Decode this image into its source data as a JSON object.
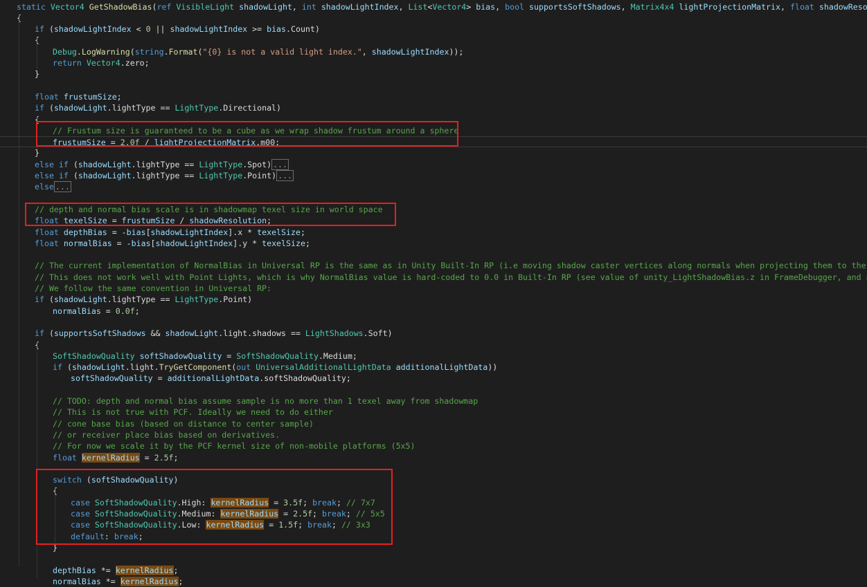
{
  "editor": {
    "lines": [
      {
        "t": [
          {
            "s": "static ",
            "c": "kw"
          },
          {
            "s": "Vector4",
            "c": "ty"
          },
          {
            "s": " "
          },
          {
            "s": "GetShadowBias",
            "c": "fn"
          },
          {
            "s": "("
          },
          {
            "s": "ref ",
            "c": "kw"
          },
          {
            "s": "VisibleLight",
            "c": "ty"
          },
          {
            "s": " "
          },
          {
            "s": "shadowLight",
            "c": "pm"
          },
          {
            "s": ", "
          },
          {
            "s": "int ",
            "c": "kw"
          },
          {
            "s": "shadowLightIndex",
            "c": "pm"
          },
          {
            "s": ", "
          },
          {
            "s": "List",
            "c": "ty"
          },
          {
            "s": "<"
          },
          {
            "s": "Vector4",
            "c": "ty"
          },
          {
            "s": "> "
          },
          {
            "s": "bias",
            "c": "pm"
          },
          {
            "s": ", "
          },
          {
            "s": "bool ",
            "c": "kw"
          },
          {
            "s": "supportsSoftShadows",
            "c": "pm"
          },
          {
            "s": ", "
          },
          {
            "s": "Matrix4x4",
            "c": "ty"
          },
          {
            "s": " "
          },
          {
            "s": "lightProjectionMatrix",
            "c": "pm"
          },
          {
            "s": ", "
          },
          {
            "s": "float ",
            "c": "kw"
          },
          {
            "s": "shadowResolution",
            "c": "pm"
          },
          {
            "s": ")"
          }
        ]
      },
      {
        "t": [
          {
            "s": "{"
          }
        ]
      },
      {
        "t": [
          {
            "s": "if",
            "c": "kw"
          },
          {
            "s": " ("
          },
          {
            "s": "shadowLightIndex",
            "c": "pm"
          },
          {
            "s": " < "
          },
          {
            "s": "0",
            "c": "nm"
          },
          {
            "s": " || "
          },
          {
            "s": "shadowLightIndex",
            "c": "pm"
          },
          {
            "s": " >= "
          },
          {
            "s": "bias",
            "c": "pm"
          },
          {
            "s": ".Count)"
          }
        ]
      },
      {
        "t": [
          {
            "s": "{"
          }
        ]
      },
      {
        "t": [
          {
            "s": "Debug",
            "c": "ty"
          },
          {
            "s": "."
          },
          {
            "s": "LogWarning",
            "c": "fn"
          },
          {
            "s": "("
          },
          {
            "s": "string",
            "c": "kw"
          },
          {
            "s": "."
          },
          {
            "s": "Format",
            "c": "fn"
          },
          {
            "s": "("
          },
          {
            "s": "\"{0} is not a valid light index.\"",
            "c": "st"
          },
          {
            "s": ", "
          },
          {
            "s": "shadowLightIndex",
            "c": "pm"
          },
          {
            "s": "));"
          }
        ]
      },
      {
        "t": [
          {
            "s": "return ",
            "c": "kw"
          },
          {
            "s": "Vector4",
            "c": "ty"
          },
          {
            "s": ".zero;"
          }
        ]
      },
      {
        "t": [
          {
            "s": "}"
          }
        ]
      },
      {
        "t": []
      },
      {
        "t": [
          {
            "s": "float ",
            "c": "kw"
          },
          {
            "s": "frustumSize",
            "c": "pm"
          },
          {
            "s": ";"
          }
        ]
      },
      {
        "t": [
          {
            "s": "if",
            "c": "kw"
          },
          {
            "s": " ("
          },
          {
            "s": "shadowLight",
            "c": "pm"
          },
          {
            "s": ".lightType == "
          },
          {
            "s": "LightType",
            "c": "ty"
          },
          {
            "s": ".Directional)"
          }
        ]
      },
      {
        "t": [
          {
            "s": "{"
          }
        ]
      },
      {
        "t": [
          {
            "s": "// Frustum size is guaranteed to be a cube as we wrap shadow frustum around a sphere",
            "c": "cm"
          }
        ]
      },
      {
        "t": [
          {
            "s": "frustumSize",
            "c": "pm"
          },
          {
            "s": " = "
          },
          {
            "s": "2.0f",
            "c": "nm"
          },
          {
            "s": " / "
          },
          {
            "s": "lightProjectionMatrix",
            "c": "pm"
          },
          {
            "s": ".m00;"
          }
        ]
      },
      {
        "t": [
          {
            "s": "}"
          }
        ]
      },
      {
        "t": [
          {
            "s": "else if",
            "c": "kw"
          },
          {
            "s": " ("
          },
          {
            "s": "shadowLight",
            "c": "pm"
          },
          {
            "s": ".lightType == "
          },
          {
            "s": "LightType",
            "c": "ty"
          },
          {
            "s": ".Spot)"
          },
          {
            "s": "...",
            "c": "fold"
          }
        ]
      },
      {
        "t": [
          {
            "s": "else if",
            "c": "kw"
          },
          {
            "s": " ("
          },
          {
            "s": "shadowLight",
            "c": "pm"
          },
          {
            "s": ".lightType == "
          },
          {
            "s": "LightType",
            "c": "ty"
          },
          {
            "s": ".Point)"
          },
          {
            "s": "...",
            "c": "fold"
          }
        ]
      },
      {
        "t": [
          {
            "s": "else",
            "c": "kw"
          },
          {
            "s": "...",
            "c": "fold"
          }
        ]
      },
      {
        "t": []
      },
      {
        "t": [
          {
            "s": "// depth and normal bias scale is in shadowmap texel size in world space",
            "c": "cm"
          }
        ]
      },
      {
        "t": [
          {
            "s": "float ",
            "c": "kw"
          },
          {
            "s": "texelSize",
            "c": "pm"
          },
          {
            "s": " = "
          },
          {
            "s": "frustumSize",
            "c": "pm"
          },
          {
            "s": " / "
          },
          {
            "s": "shadowResolution",
            "c": "pm"
          },
          {
            "s": ";"
          }
        ]
      },
      {
        "t": [
          {
            "s": "float ",
            "c": "kw"
          },
          {
            "s": "depthBias",
            "c": "pm"
          },
          {
            "s": " = -"
          },
          {
            "s": "bias",
            "c": "pm"
          },
          {
            "s": "["
          },
          {
            "s": "shadowLightIndex",
            "c": "pm"
          },
          {
            "s": "].x * "
          },
          {
            "s": "texelSize",
            "c": "pm"
          },
          {
            "s": ";"
          }
        ]
      },
      {
        "t": [
          {
            "s": "float ",
            "c": "kw"
          },
          {
            "s": "normalBias",
            "c": "pm"
          },
          {
            "s": " = -"
          },
          {
            "s": "bias",
            "c": "pm"
          },
          {
            "s": "["
          },
          {
            "s": "shadowLightIndex",
            "c": "pm"
          },
          {
            "s": "].y * "
          },
          {
            "s": "texelSize",
            "c": "pm"
          },
          {
            "s": ";"
          }
        ]
      },
      {
        "t": []
      },
      {
        "t": [
          {
            "s": "// The current implementation of NormalBias in Universal RP is the same as in Unity Built-In RP (i.e moving shadow caster vertices along normals when projecting them to the shadow map",
            "c": "cm"
          }
        ]
      },
      {
        "t": [
          {
            "s": "// This does not work well with Point Lights, which is why NormalBias value is hard-coded to 0.0 in Built-In RP (see value of unity_LightShadowBias.z in FrameDebugger, and native code",
            "c": "cm"
          }
        ]
      },
      {
        "t": [
          {
            "s": "// We follow the same convention in Universal RP:",
            "c": "cm"
          }
        ]
      },
      {
        "t": [
          {
            "s": "if",
            "c": "kw"
          },
          {
            "s": " ("
          },
          {
            "s": "shadowLight",
            "c": "pm"
          },
          {
            "s": ".lightType == "
          },
          {
            "s": "LightType",
            "c": "ty"
          },
          {
            "s": ".Point)"
          }
        ]
      },
      {
        "t": [
          {
            "s": "normalBias",
            "c": "pm"
          },
          {
            "s": " = "
          },
          {
            "s": "0.0f",
            "c": "nm"
          },
          {
            "s": ";"
          }
        ]
      },
      {
        "t": []
      },
      {
        "t": [
          {
            "s": "if",
            "c": "kw"
          },
          {
            "s": " ("
          },
          {
            "s": "supportsSoftShadows",
            "c": "pm"
          },
          {
            "s": " && "
          },
          {
            "s": "shadowLight",
            "c": "pm"
          },
          {
            "s": ".light.shadows == "
          },
          {
            "s": "LightShadows",
            "c": "ty"
          },
          {
            "s": ".Soft)"
          }
        ]
      },
      {
        "t": [
          {
            "s": "{"
          }
        ]
      },
      {
        "t": [
          {
            "s": "SoftShadowQuality",
            "c": "ty"
          },
          {
            "s": " "
          },
          {
            "s": "softShadowQuality",
            "c": "pm"
          },
          {
            "s": " = "
          },
          {
            "s": "SoftShadowQuality",
            "c": "ty"
          },
          {
            "s": ".Medium;"
          }
        ]
      },
      {
        "t": [
          {
            "s": "if",
            "c": "kw"
          },
          {
            "s": " ("
          },
          {
            "s": "shadowLight",
            "c": "pm"
          },
          {
            "s": ".light."
          },
          {
            "s": "TryGetComponent",
            "c": "fn"
          },
          {
            "s": "("
          },
          {
            "s": "out ",
            "c": "kw"
          },
          {
            "s": "UniversalAdditionalLightData",
            "c": "ty"
          },
          {
            "s": " "
          },
          {
            "s": "additionalLightData",
            "c": "pm"
          },
          {
            "s": "))"
          }
        ]
      },
      {
        "t": [
          {
            "s": "softShadowQuality",
            "c": "pm"
          },
          {
            "s": " = "
          },
          {
            "s": "additionalLightData",
            "c": "pm"
          },
          {
            "s": ".softShadowQuality;"
          }
        ]
      },
      {
        "t": []
      },
      {
        "t": [
          {
            "s": "// TODO: depth and normal bias assume sample is no more than 1 texel away from shadowmap",
            "c": "cm"
          }
        ]
      },
      {
        "t": [
          {
            "s": "// This is not true with PCF. Ideally we need to do either",
            "c": "cm"
          }
        ]
      },
      {
        "t": [
          {
            "s": "// cone base bias (based on distance to center sample)",
            "c": "cm"
          }
        ]
      },
      {
        "t": [
          {
            "s": "// or receiver place bias based on derivatives.",
            "c": "cm"
          }
        ]
      },
      {
        "t": [
          {
            "s": "// For now we scale it by the PCF kernel size of non-mobile platforms (5x5)",
            "c": "cm"
          }
        ]
      },
      {
        "t": [
          {
            "s": "float ",
            "c": "kw"
          },
          {
            "s": "kernelRadius",
            "c": "pm hi"
          },
          {
            "s": " = "
          },
          {
            "s": "2.5f",
            "c": "nm"
          },
          {
            "s": ";"
          }
        ]
      },
      {
        "t": []
      },
      {
        "t": [
          {
            "s": "switch",
            "c": "kw"
          },
          {
            "s": " ("
          },
          {
            "s": "softShadowQuality",
            "c": "pm"
          },
          {
            "s": ")"
          }
        ]
      },
      {
        "t": [
          {
            "s": "{"
          }
        ]
      },
      {
        "t": [
          {
            "s": "case ",
            "c": "kw"
          },
          {
            "s": "SoftShadowQuality",
            "c": "ty"
          },
          {
            "s": ".High: "
          },
          {
            "s": "kernelRadius",
            "c": "pm hi"
          },
          {
            "s": " = "
          },
          {
            "s": "3.5f",
            "c": "nm"
          },
          {
            "s": "; "
          },
          {
            "s": "break",
            "c": "kw"
          },
          {
            "s": "; "
          },
          {
            "s": "// 7x7",
            "c": "cm"
          }
        ]
      },
      {
        "t": [
          {
            "s": "case ",
            "c": "kw"
          },
          {
            "s": "SoftShadowQuality",
            "c": "ty"
          },
          {
            "s": ".Medium: "
          },
          {
            "s": "kernelRadius",
            "c": "pm hi"
          },
          {
            "s": " = "
          },
          {
            "s": "2.5f",
            "c": "nm"
          },
          {
            "s": "; "
          },
          {
            "s": "break",
            "c": "kw"
          },
          {
            "s": "; "
          },
          {
            "s": "// 5x5",
            "c": "cm"
          }
        ]
      },
      {
        "t": [
          {
            "s": "case ",
            "c": "kw"
          },
          {
            "s": "SoftShadowQuality",
            "c": "ty"
          },
          {
            "s": ".Low: "
          },
          {
            "s": "kernelRadius",
            "c": "pm hi"
          },
          {
            "s": " = "
          },
          {
            "s": "1.5f",
            "c": "nm"
          },
          {
            "s": "; "
          },
          {
            "s": "break",
            "c": "kw"
          },
          {
            "s": "; "
          },
          {
            "s": "// 3x3",
            "c": "cm"
          }
        ]
      },
      {
        "t": [
          {
            "s": "default",
            "c": "kw"
          },
          {
            "s": ": "
          },
          {
            "s": "break",
            "c": "kw"
          },
          {
            "s": ";"
          }
        ]
      },
      {
        "t": [
          {
            "s": "}"
          }
        ]
      },
      {
        "t": []
      },
      {
        "t": [
          {
            "s": "depthBias",
            "c": "pm"
          },
          {
            "s": " *= "
          },
          {
            "s": "kernelRadius",
            "c": "pm hi"
          },
          {
            "s": ";"
          }
        ]
      },
      {
        "t": [
          {
            "s": "normalBias",
            "c": "pm"
          },
          {
            "s": " *= "
          },
          {
            "s": "kernelRadius",
            "c": "pm hi"
          },
          {
            "s": ";"
          }
        ]
      }
    ]
  }
}
